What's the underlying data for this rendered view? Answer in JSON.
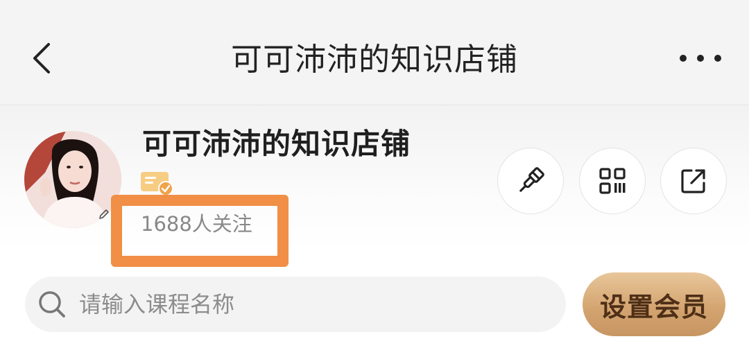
{
  "navbar": {
    "title": "可可沛沛的知识店铺",
    "back_icon": "chevron-left-icon",
    "more_icon": "more-dots-icon"
  },
  "shop": {
    "name": "可可沛沛的知识店铺",
    "followers": "1688人关注",
    "badge_icon": "verified-badge-icon",
    "actions": [
      {
        "icon": "brush-icon"
      },
      {
        "icon": "qr-code-icon"
      },
      {
        "icon": "share-icon"
      }
    ]
  },
  "search": {
    "placeholder": "请输入课程名称"
  },
  "member_button": {
    "label": "设置会员"
  },
  "colors": {
    "highlight": "#f08f45",
    "member_gold": "#d4a571",
    "member_text": "#4e2f17",
    "badge": "#f5c06a"
  }
}
